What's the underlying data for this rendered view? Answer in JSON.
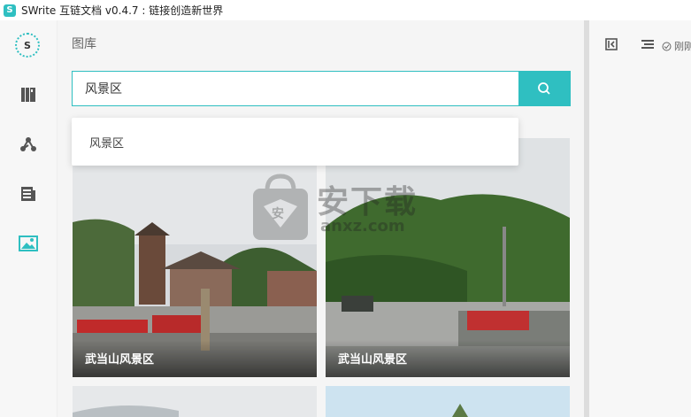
{
  "window": {
    "title": "SWrite 互链文档 v0.4.7 : 链接创造新世界",
    "app_icon_letter": "S"
  },
  "rail": {
    "logo_letter": "S",
    "items": [
      {
        "name": "library-book-icon"
      },
      {
        "name": "graph-nodes-icon"
      },
      {
        "name": "document-icon"
      },
      {
        "name": "image-gallery-icon",
        "active": true
      }
    ]
  },
  "panel": {
    "title": "图库",
    "search": {
      "value": "风景区"
    },
    "suggestions": [
      "风景区"
    ],
    "cards": [
      {
        "caption": "武当山风景区"
      },
      {
        "caption": "武当山风景区"
      }
    ]
  },
  "watermark": {
    "text": "安下载",
    "sub": "anxz.com",
    "badge": "安"
  },
  "right": {
    "saved_label": "刚刚"
  },
  "colors": {
    "accent": "#2fbfc1"
  }
}
